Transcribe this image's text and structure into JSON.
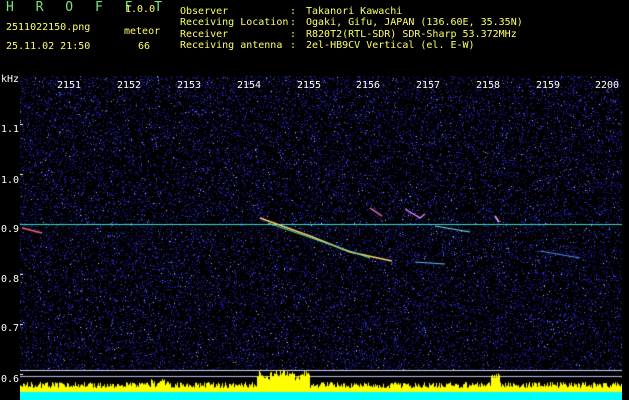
{
  "header": {
    "app_name": "H R O F F T",
    "app_version": "1.0.0",
    "file_name": "2511022150.png",
    "timestamp": "25.11.02 21:50",
    "meteor_label": "meteor",
    "meteor_count": "66"
  },
  "station_info": [
    {
      "key": "Observer",
      "sep": ":",
      "value": "Takanori Kawachi"
    },
    {
      "key": "Receiving Location",
      "sep": ":",
      "value": "Ogaki, Gifu, JAPAN (136.60E, 35.35N)"
    },
    {
      "key": "Receiver",
      "sep": ":",
      "value": "R820T2(RTL-SDR) SDR-Sharp 53.372MHz"
    },
    {
      "key": "Receiving antenna",
      "sep": ":",
      "value": "2el-HB9CV Vertical (el. E-W)"
    }
  ],
  "axes": {
    "freq_unit": "kHz",
    "time_ticks": [
      "2151",
      "2152",
      "2153",
      "2154",
      "2155",
      "2156",
      "2157",
      "2158",
      "2159",
      "2200"
    ],
    "freq_ticks": [
      "1.1",
      "1.0",
      "0.9",
      "0.8",
      "0.7",
      "0.6"
    ]
  },
  "colors": {
    "background": "#000000",
    "noise_blue": "#1a1aa8",
    "carrier_line": "#33ddcc",
    "header_green": "#7fe07f",
    "header_yellow": "#ffff66",
    "activity_bars": "#ffff00",
    "baseline_cyan": "#00ffff"
  }
}
